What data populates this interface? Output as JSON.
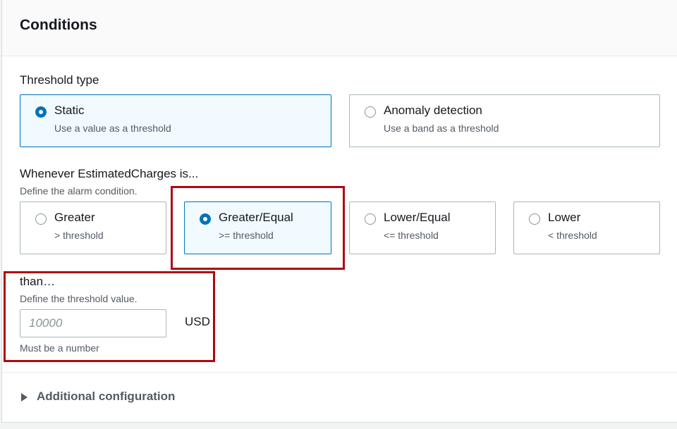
{
  "conditions": {
    "title": "Conditions",
    "threshold_type": {
      "label": "Threshold type",
      "options": [
        {
          "title": "Static",
          "subtitle": "Use a value as a threshold",
          "selected": true
        },
        {
          "title": "Anomaly detection",
          "subtitle": "Use a band as a threshold",
          "selected": false
        }
      ]
    },
    "comparison": {
      "label": "Whenever EstimatedCharges is...",
      "description": "Define the alarm condition.",
      "options": [
        {
          "title": "Greater",
          "subtitle": "> threshold",
          "selected": false
        },
        {
          "title": "Greater/Equal",
          "subtitle": ">= threshold",
          "selected": true
        },
        {
          "title": "Lower/Equal",
          "subtitle": "<= threshold",
          "selected": false
        },
        {
          "title": "Lower",
          "subtitle": "< threshold",
          "selected": false
        }
      ]
    },
    "threshold": {
      "label": "than…",
      "description": "Define the threshold value.",
      "placeholder": "10000",
      "value": "",
      "unit": "USD",
      "constraint": "Must be a number"
    },
    "additional": {
      "label": "Additional configuration"
    }
  },
  "colors": {
    "accent": "#0073bb",
    "highlight": "#b0070f",
    "selected_bg": "#f1faff"
  }
}
